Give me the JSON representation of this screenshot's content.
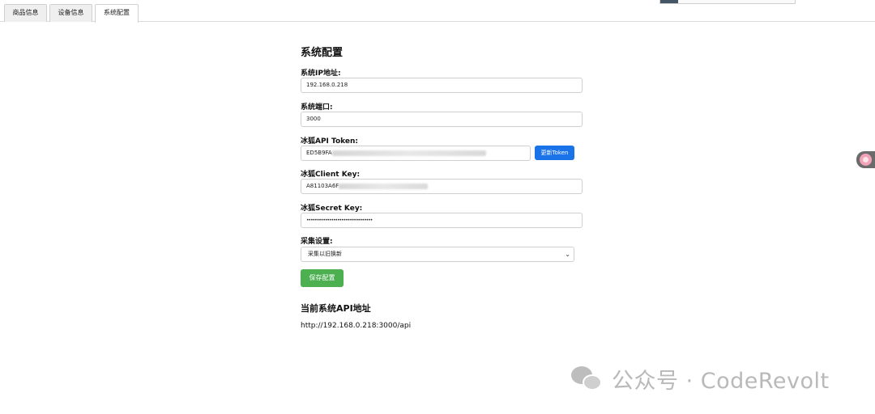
{
  "tabs": [
    {
      "label": "商品信息"
    },
    {
      "label": "设备信息"
    },
    {
      "label": "系统配置",
      "active": true
    }
  ],
  "form": {
    "title": "系统配置",
    "ip_label": "系统IP地址:",
    "ip_value": "192.168.0.218",
    "port_label": "系统端口:",
    "port_value": "3000",
    "token_label": "冰狐API Token:",
    "token_value_visible": "ED5B9FA",
    "token_button": "更新Token",
    "client_key_label": "冰狐Client Key:",
    "client_key_visible": "A81103A6F",
    "secret_key_label": "冰狐Secret Key:",
    "secret_key_masked": "••••••••••••••••••••••••••••••••",
    "collect_label": "采集设置:",
    "collect_selected": "采集以旧换新",
    "save_button": "保存配置"
  },
  "api": {
    "title": "当前系统API地址",
    "url": "http://192.168.0.218:3000/api"
  },
  "watermark": {
    "text": "公众号 · CodeRevolt"
  }
}
